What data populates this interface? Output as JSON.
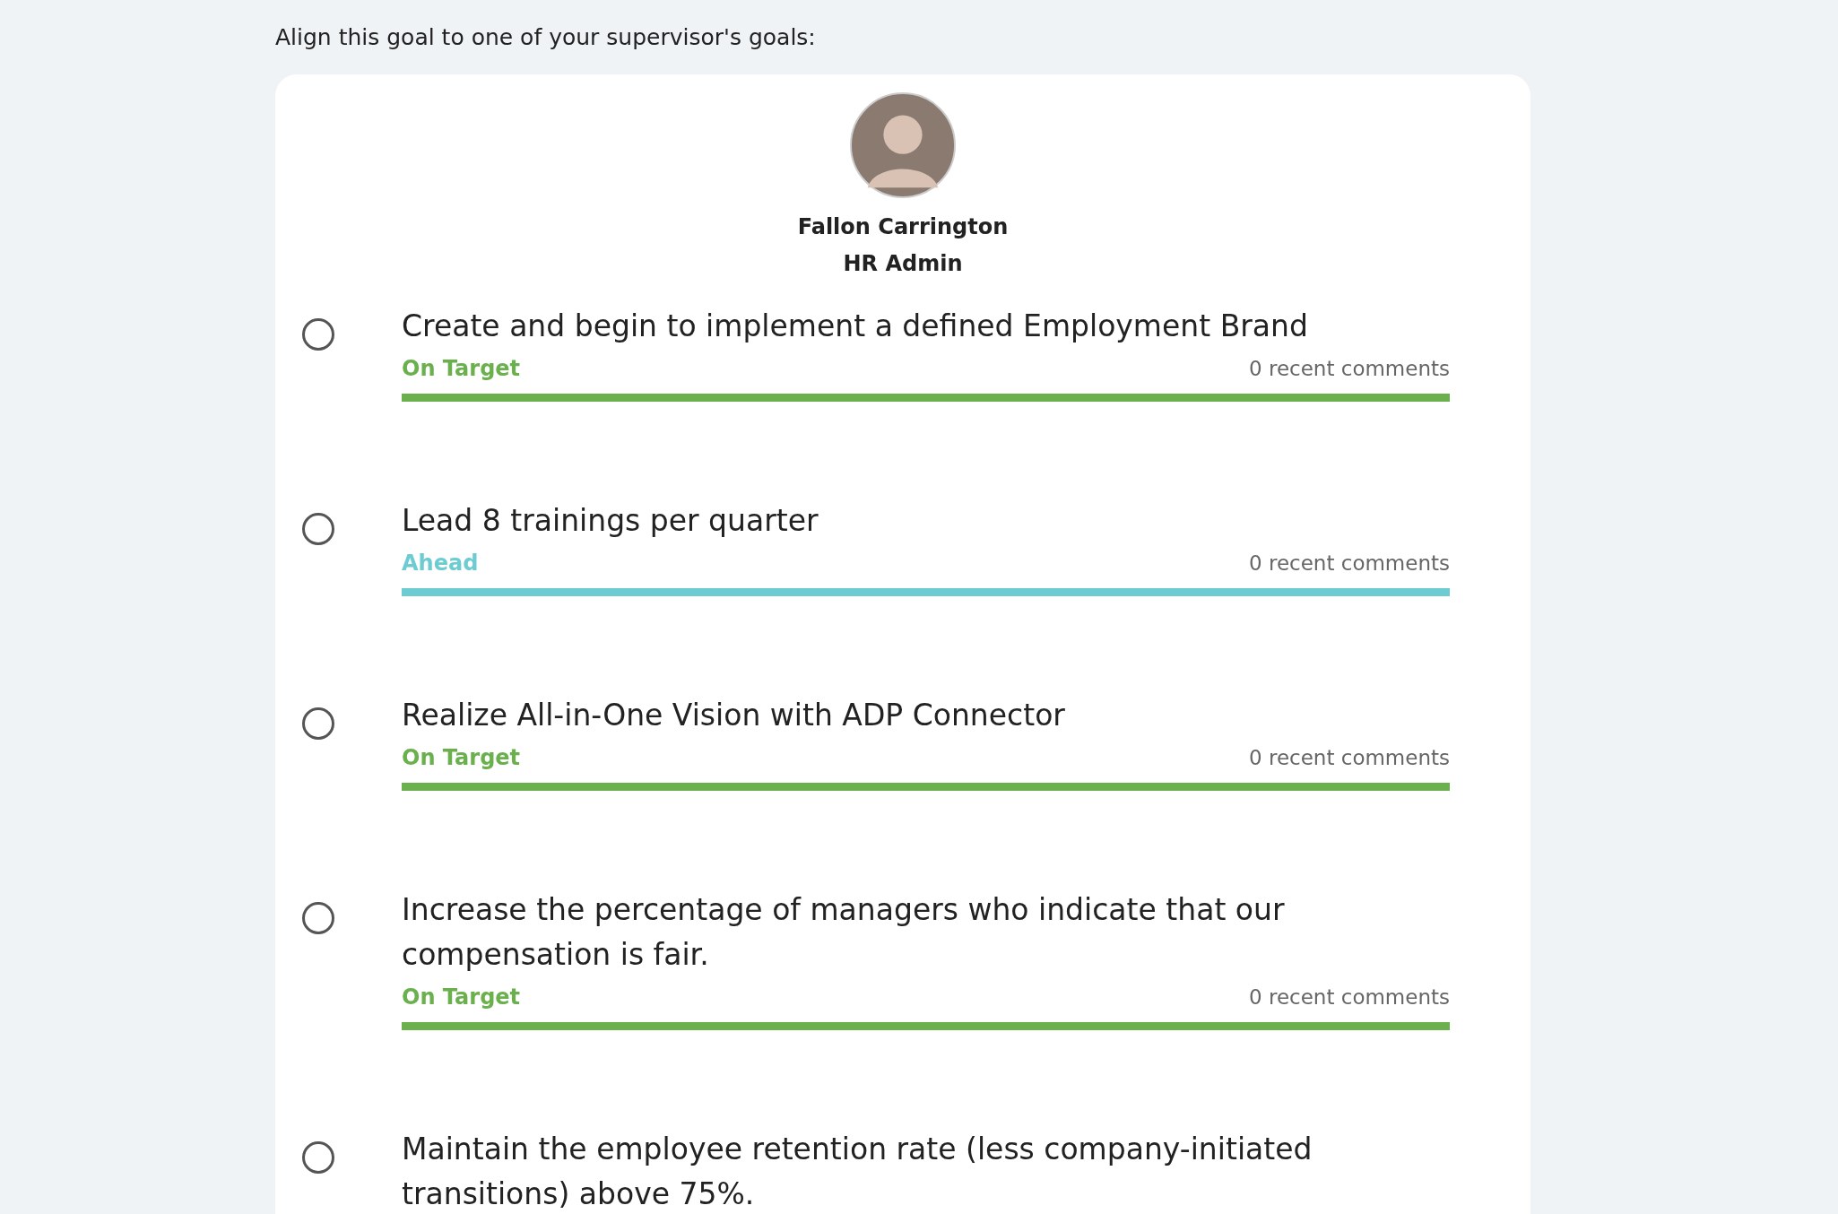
{
  "prompt": "Align this goal to one of your supervisor's goals:",
  "supervisor": {
    "name": "Fallon Carrington",
    "role": "HR Admin"
  },
  "goals": [
    {
      "title": "Create and begin to implement a defined Employment Brand",
      "status": "On Target",
      "color": "#6ab04c",
      "comments": "0 recent comments",
      "level": 1,
      "selected": false
    },
    {
      "title": "Lead 8 trainings per quarter",
      "status": "Ahead",
      "color": "#6dcbd2",
      "comments": "0 recent comments",
      "level": 1,
      "selected": false
    },
    {
      "title": "Realize All-in-One Vision with ADP Connector",
      "status": "On Target",
      "color": "#6ab04c",
      "comments": "0 recent comments",
      "level": 1,
      "selected": false
    },
    {
      "title": "Increase the percentage of managers who indicate that our compensation is fair.",
      "status": "On Target",
      "color": "#6ab04c",
      "comments": "0 recent comments",
      "level": 1,
      "selected": false
    },
    {
      "title": "Maintain the employee retention rate (less company-initiated transitions) above 75%.",
      "selected": false
    }
  ]
}
